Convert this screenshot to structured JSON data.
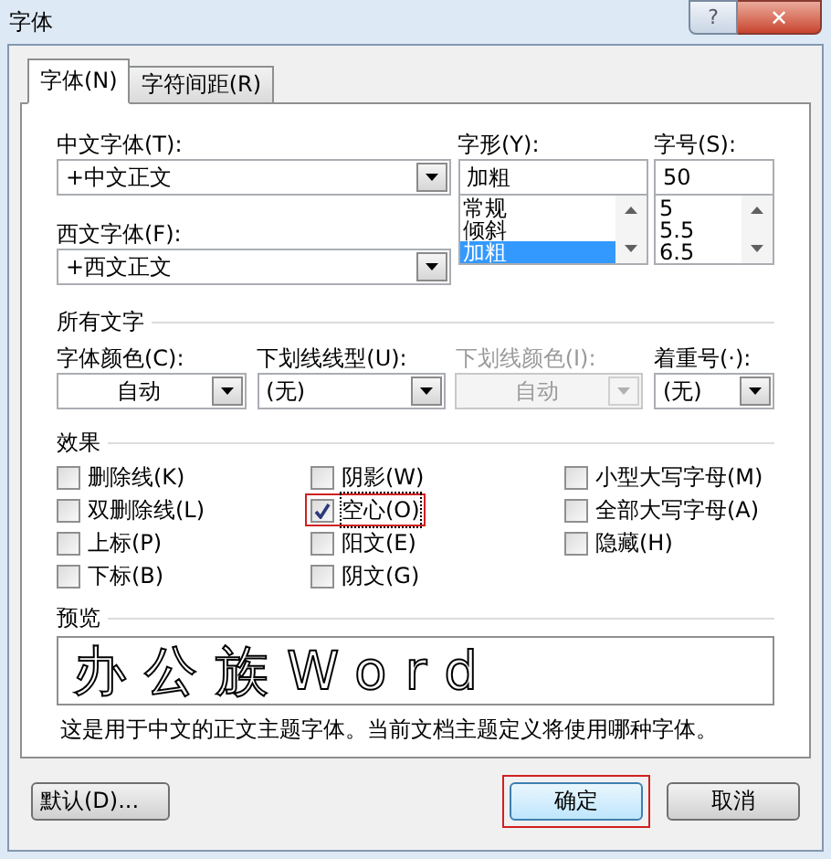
{
  "window": {
    "title": "字体",
    "help": "?",
    "close": "✕"
  },
  "tabs": [
    {
      "label": "字体(N)",
      "selected": true
    },
    {
      "label": "字符间距(R)",
      "selected": false
    }
  ],
  "font": {
    "chinese": {
      "label": "中文字体(T):",
      "value": "+中文正文"
    },
    "western": {
      "label": "西文字体(F):",
      "value": "+西文正文"
    },
    "style": {
      "label": "字形(Y):",
      "value": "加粗",
      "options": [
        {
          "label": "常规",
          "selected": false
        },
        {
          "label": "倾斜",
          "selected": false
        },
        {
          "label": "加粗",
          "selected": true
        }
      ]
    },
    "size": {
      "label": "字号(S):",
      "value": "50",
      "options": [
        {
          "label": "5",
          "selected": false
        },
        {
          "label": "5.5",
          "selected": false
        },
        {
          "label": "6.5",
          "selected": false
        }
      ]
    }
  },
  "all_text": {
    "title": "所有文字",
    "combos": [
      {
        "label": "字体颜色(C):",
        "value": "自动",
        "centered": true,
        "disabled": false
      },
      {
        "label": "下划线线型(U):",
        "value": "(无)",
        "centered": false,
        "disabled": false
      },
      {
        "label": "下划线颜色(I):",
        "value": "自动",
        "centered": true,
        "disabled": true
      },
      {
        "label": "着重号(·):",
        "value": "(无)",
        "centered": false,
        "disabled": false
      }
    ]
  },
  "effects": {
    "title": "效果",
    "columns": [
      [
        {
          "label": "删除线(K)",
          "checked": false,
          "highlighted": false
        },
        {
          "label": "双删除线(L)",
          "checked": false,
          "highlighted": false
        },
        {
          "label": "上标(P)",
          "checked": false,
          "highlighted": false
        },
        {
          "label": "下标(B)",
          "checked": false,
          "highlighted": false
        }
      ],
      [
        {
          "label": "阴影(W)",
          "checked": false,
          "highlighted": false
        },
        {
          "label": "空心(O)",
          "checked": true,
          "highlighted": true
        },
        {
          "label": "阳文(E)",
          "checked": false,
          "highlighted": false
        },
        {
          "label": "阴文(G)",
          "checked": false,
          "highlighted": false
        }
      ],
      [
        {
          "label": "小型大写字母(M)",
          "checked": false,
          "highlighted": false
        },
        {
          "label": "全部大写字母(A)",
          "checked": false,
          "highlighted": false
        },
        {
          "label": "隐藏(H)",
          "checked": false,
          "highlighted": false
        }
      ]
    ]
  },
  "preview": {
    "title": "预览",
    "sample": "办公族Word",
    "description": "这是用于中文的正文主题字体。当前文档主题定义将使用哪种字体。"
  },
  "buttons": [
    {
      "label": "默认(D)...",
      "kind": "left",
      "highlighted": false
    },
    {
      "label": "确定",
      "kind": "default",
      "highlighted": true
    },
    {
      "label": "取消",
      "kind": "normal",
      "highlighted": false
    }
  ]
}
